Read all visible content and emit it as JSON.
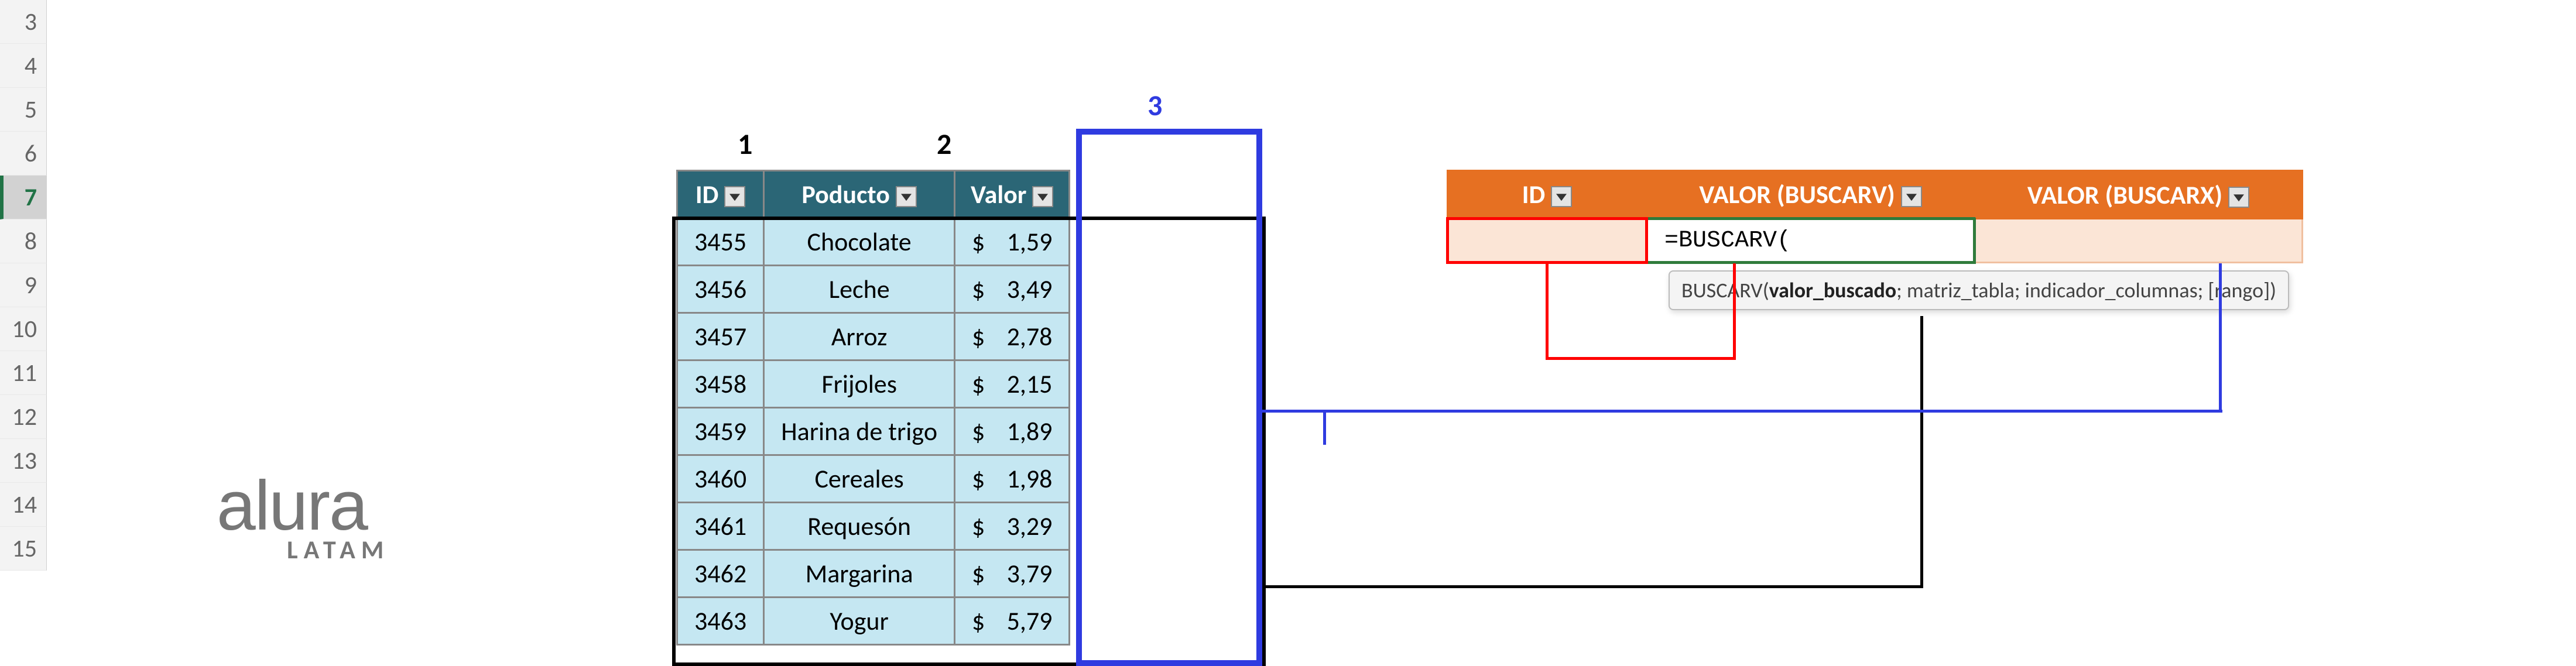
{
  "row_numbers": [
    "3",
    "4",
    "5",
    "6",
    "7",
    "8",
    "9",
    "10",
    "11",
    "12",
    "13",
    "14",
    "15"
  ],
  "selected_row_index": 4,
  "col_labels": {
    "c1": "1",
    "c2": "2",
    "c3": "3"
  },
  "src_headers": {
    "id": "ID",
    "producto": "Poducto",
    "valor": "Valor"
  },
  "src_rows": [
    {
      "id": "3455",
      "prod": "Chocolate",
      "cur": "$",
      "val": "1,59"
    },
    {
      "id": "3456",
      "prod": "Leche",
      "cur": "$",
      "val": "3,49"
    },
    {
      "id": "3457",
      "prod": "Arroz",
      "cur": "$",
      "val": "2,78"
    },
    {
      "id": "3458",
      "prod": "Frijoles",
      "cur": "$",
      "val": "2,15"
    },
    {
      "id": "3459",
      "prod": "Harina de trigo",
      "cur": "$",
      "val": "1,89"
    },
    {
      "id": "3460",
      "prod": "Cereales",
      "cur": "$",
      "val": "1,98"
    },
    {
      "id": "3461",
      "prod": "Requesón",
      "cur": "$",
      "val": "3,29"
    },
    {
      "id": "3462",
      "prod": "Margarina",
      "cur": "$",
      "val": "3,79"
    },
    {
      "id": "3463",
      "prod": "Yogur",
      "cur": "$",
      "val": "5,79"
    }
  ],
  "res_headers": {
    "id": "ID",
    "v1": "VALOR (BUSCARV)",
    "v2": "VALOR (BUSCARX)"
  },
  "formula": "=BUSCARV(",
  "tooltip": {
    "fn": "BUSCARV(",
    "arg1": "valor_buscado",
    "rest": "; matriz_tabla; indicador_columnas; [rango])"
  },
  "logo": {
    "main": "alura",
    "sub": "LATAM"
  },
  "colors": {
    "src_header": "#2b6676",
    "src_cell": "#c5e7f2",
    "res_header": "#e67022",
    "res_cell": "#fbe5d6",
    "annot_blue": "#2f3be0",
    "annot_red": "#ff0000"
  }
}
